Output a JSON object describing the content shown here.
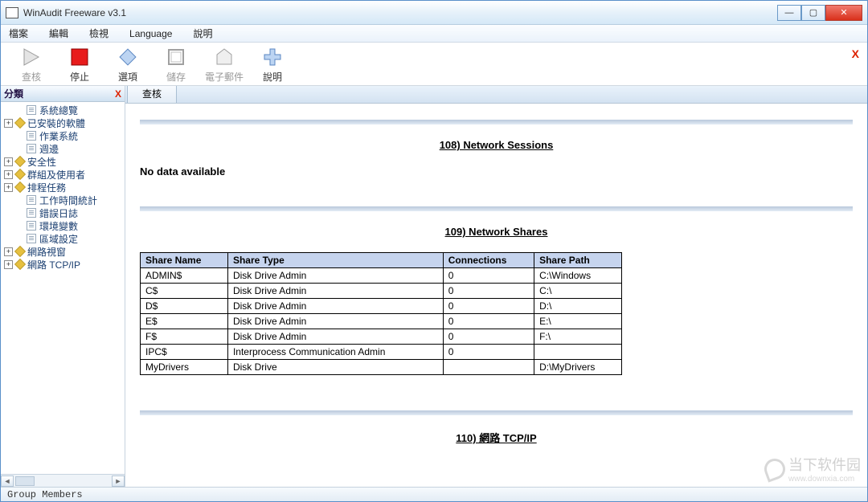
{
  "window": {
    "title": "WinAudit Freeware v3.1"
  },
  "menu": {
    "file": "檔案",
    "edit": "編輯",
    "view": "檢視",
    "language": "Language",
    "help": "說明"
  },
  "toolbar": {
    "audit": "查核",
    "stop": "停止",
    "options": "選項",
    "save": "儲存",
    "email": "電子郵件",
    "help": "說明"
  },
  "sidebar": {
    "title": "分類",
    "items": [
      {
        "type": "page",
        "indent": 1,
        "label": "系統總覽"
      },
      {
        "type": "branch",
        "indent": 0,
        "label": "已安裝的軟體"
      },
      {
        "type": "page",
        "indent": 1,
        "label": "作業系統"
      },
      {
        "type": "page",
        "indent": 1,
        "label": "週邊"
      },
      {
        "type": "branch",
        "indent": 0,
        "label": "安全性"
      },
      {
        "type": "branch",
        "indent": 0,
        "label": "群組及使用者"
      },
      {
        "type": "branch",
        "indent": 0,
        "label": "排程任務"
      },
      {
        "type": "page",
        "indent": 1,
        "label": "工作時間統計"
      },
      {
        "type": "page",
        "indent": 1,
        "label": "錯誤日誌"
      },
      {
        "type": "page",
        "indent": 1,
        "label": "環境變數"
      },
      {
        "type": "page",
        "indent": 1,
        "label": "區域設定"
      },
      {
        "type": "branch",
        "indent": 0,
        "label": "網路視窗"
      },
      {
        "type": "branch",
        "indent": 0,
        "label": "網路 TCP/IP"
      }
    ]
  },
  "tab": {
    "audit": "查核"
  },
  "sections": {
    "s108": {
      "title": "108) Network Sessions",
      "no_data": "No data available"
    },
    "s109": {
      "title": "109) Network Shares",
      "headers": [
        "Share Name",
        "Share Type",
        "Connections",
        "Share Path"
      ],
      "rows": [
        [
          "ADMIN$",
          "Disk Drive Admin",
          "0",
          "C:\\Windows"
        ],
        [
          "C$",
          "Disk Drive Admin",
          "0",
          "C:\\"
        ],
        [
          "D$",
          "Disk Drive Admin",
          "0",
          "D:\\"
        ],
        [
          "E$",
          "Disk Drive Admin",
          "0",
          "E:\\"
        ],
        [
          "F$",
          "Disk Drive Admin",
          "0",
          "F:\\"
        ],
        [
          "IPC$",
          "Interprocess Communication Admin",
          "0",
          ""
        ],
        [
          "MyDrivers",
          "Disk Drive",
          "",
          "D:\\MyDrivers"
        ]
      ]
    },
    "s110": {
      "title": "110) 網路 TCP/IP"
    }
  },
  "status": "Group Members",
  "watermark": {
    "text": "当下软件园",
    "url": "www.downxia.com"
  }
}
